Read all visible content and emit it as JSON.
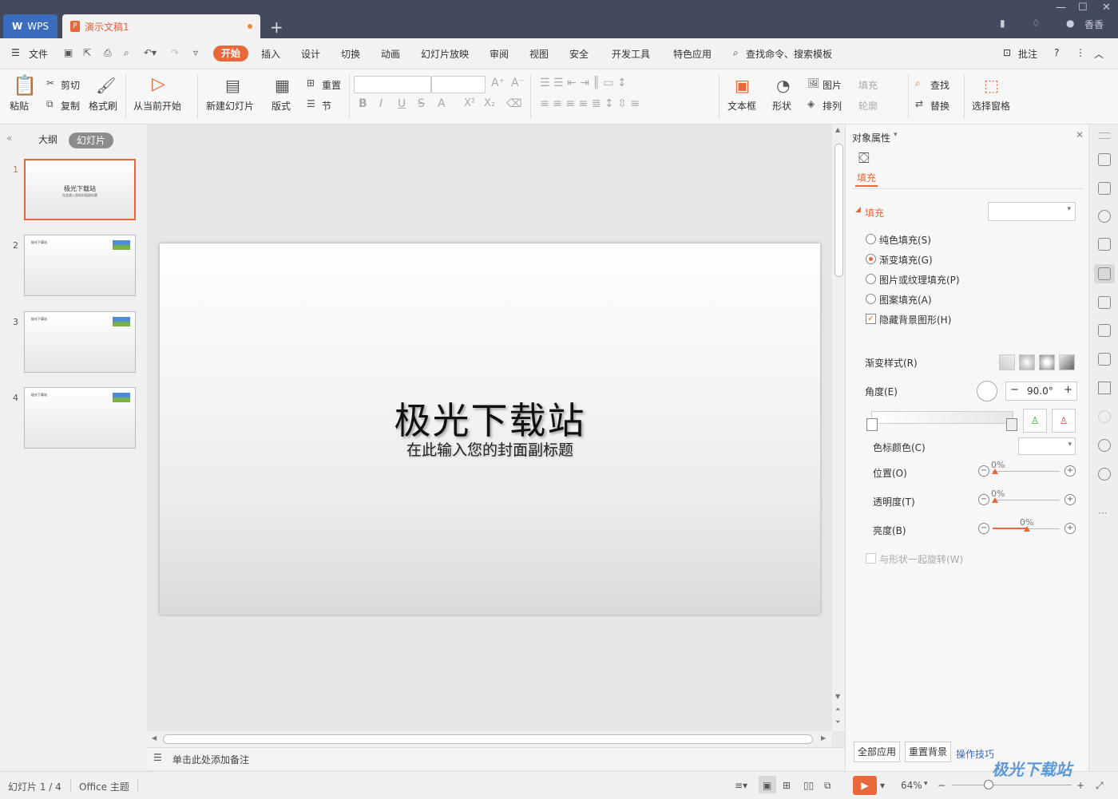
{
  "titlebar": {
    "wps_tab": "WPS",
    "doc_tab": "演示文稿1",
    "user": "香香"
  },
  "menu": {
    "file": "文件",
    "items": [
      "开始",
      "插入",
      "设计",
      "切换",
      "动画",
      "幻灯片放映",
      "审阅",
      "视图",
      "安全",
      "开发工具",
      "特色应用"
    ],
    "search": "查找命令、搜索模板",
    "comment": "批注"
  },
  "ribbon": {
    "paste": "粘贴",
    "cut": "剪切",
    "copy": "复制",
    "format_painter": "格式刷",
    "from_current": "从当前开始",
    "new_slide": "新建幻灯片",
    "layout": "版式",
    "reset": "重置",
    "section": "节",
    "textbox": "文本框",
    "shape": "形状",
    "picture": "图片",
    "arrange": "排列",
    "fill": "填充",
    "outline": "轮廓",
    "find": "查找",
    "replace": "替换",
    "selection_pane": "选择窗格"
  },
  "leftpanel": {
    "tab_outline": "大纲",
    "tab_slides": "幻灯片",
    "slides": [
      {
        "num": "1",
        "title": "极光下载站",
        "sub": "在此输入您的封面副标题"
      },
      {
        "num": "2",
        "title": "极光下载站"
      },
      {
        "num": "3",
        "title": "极光下载站"
      },
      {
        "num": "4",
        "title": "极光下载站"
      }
    ]
  },
  "slide": {
    "title": "极光下载站",
    "subtitle": "在此输入您的封面副标题"
  },
  "notes": "单击此处添加备注",
  "props": {
    "header": "对象属性",
    "tab_fill": "填充",
    "section_fill": "填充",
    "options": [
      "纯色填充(S)",
      "渐变填充(G)",
      "图片或纹理填充(P)",
      "图案填充(A)"
    ],
    "selected_option": "渐变填充(G)",
    "hide_bg": "隐藏背景图形(H)",
    "gradient_style": "渐变样式(R)",
    "angle_label": "角度(E)",
    "angle_value": "90.0°",
    "stop_color": "色标颜色(C)",
    "position_label": "位置(O)",
    "position_value": "0%",
    "transparency_label": "透明度(T)",
    "transparency_value": "0%",
    "brightness_label": "亮度(B)",
    "brightness_value": "0%",
    "rotate_with_shape": "与形状一起旋转(W)",
    "apply_all": "全部应用",
    "reset_bg": "重置背景",
    "tips": "操作技巧"
  },
  "status": {
    "slide_counter": "幻灯片 1 / 4",
    "theme": "Office 主题",
    "zoom": "64%"
  },
  "watermark": "极光下载站",
  "colors": {
    "accent": "#e8683a",
    "titlebar": "#444a5e",
    "wps_blue": "#3b6dbf"
  }
}
